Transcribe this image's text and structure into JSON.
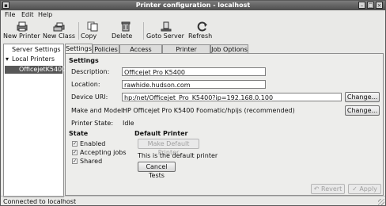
{
  "window": {
    "title": "Printer configuration - localhost"
  },
  "menubar": {
    "file": "File",
    "edit": "Edit",
    "help": "Help"
  },
  "toolbar": {
    "new_printer": "New Printer",
    "new_class": "New Class",
    "copy": "Copy",
    "delete": "Delete",
    "goto_server": "Goto Server",
    "refresh": "Refresh"
  },
  "tree": {
    "server_settings": "Server Settings",
    "local_printers": "Local Printers",
    "selected_printer": "OfficejetK5400"
  },
  "tabs": [
    "Settings",
    "Policies",
    "Access control",
    "Printer Options",
    "Job Options"
  ],
  "settings": {
    "heading": "Settings",
    "description_label": "Description:",
    "description_value": "Officejet Pro K5400",
    "location_label": "Location:",
    "location_value": "rawhide.hudson.com",
    "device_uri_label": "Device URI:",
    "device_uri_value": "hp:/net/Officejet_Pro_K5400?ip=192.168.0.100",
    "change_button": "Change...",
    "make_model_label": "Make and Model:",
    "make_model_value": "HP Officejet Pro K5400 Foomatic/hpijs (recommended)",
    "make_change_button": "Change...",
    "printer_state_label": "Printer State:",
    "printer_state_value": "Idle"
  },
  "state": {
    "heading": "State",
    "enabled": "Enabled",
    "accepting_jobs": "Accepting jobs",
    "shared": "Shared"
  },
  "default_printer": {
    "heading": "Default Printer",
    "make_default_button": "Make Default Printer",
    "default_text": "This is the default printer",
    "cancel_tests_button": "Cancel Tests"
  },
  "footer": {
    "revert_button": "Revert",
    "apply_button": "Apply"
  },
  "statusbar": {
    "text": "Connected to localhost"
  }
}
